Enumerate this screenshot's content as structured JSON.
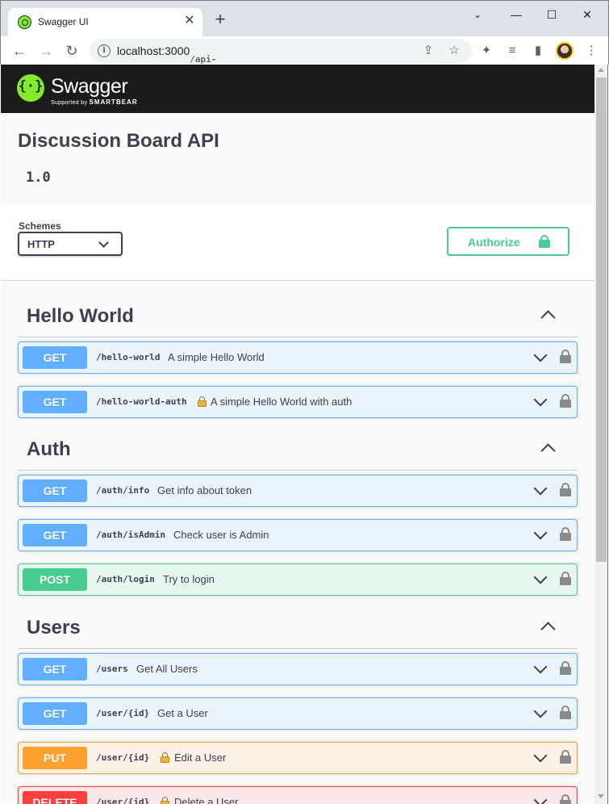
{
  "browser": {
    "tab_title": "Swagger UI",
    "tab_close": "✕",
    "new_tab": "+",
    "url_host": "localhost:3000",
    "url_path": "/api-docs/",
    "minimize": "—",
    "maximize": "☐",
    "close": "✕"
  },
  "swagger": {
    "logo_text": "Swagger",
    "logo_sub_prefix": "Supported by",
    "logo_sub_brand": "SMARTBEAR"
  },
  "info": {
    "title": "Discussion Board API",
    "version": "1.0"
  },
  "schemes": {
    "label": "Schemes",
    "selected": "HTTP"
  },
  "authorize": {
    "label": "Authorize"
  },
  "tags": [
    {
      "name": "Hello World",
      "operations": [
        {
          "method": "GET",
          "path": "/hello-world",
          "summary": "A simple Hello World",
          "locked": false
        },
        {
          "method": "GET",
          "path": "/hello-world-auth",
          "summary": "A simple Hello World with auth",
          "locked": true
        }
      ]
    },
    {
      "name": "Auth",
      "operations": [
        {
          "method": "GET",
          "path": "/auth/info",
          "summary": "Get info about token",
          "locked": false
        },
        {
          "method": "GET",
          "path": "/auth/isAdmin",
          "summary": "Check user is Admin",
          "locked": false
        },
        {
          "method": "POST",
          "path": "/auth/login",
          "summary": "Try to login",
          "locked": false
        }
      ]
    },
    {
      "name": "Users",
      "operations": [
        {
          "method": "GET",
          "path": "/users",
          "summary": "Get All Users",
          "locked": false
        },
        {
          "method": "GET",
          "path": "/user/{id}",
          "summary": "Get a User",
          "locked": false
        },
        {
          "method": "PUT",
          "path": "/user/{id}",
          "summary": "Edit a User",
          "locked": true
        },
        {
          "method": "DELETE",
          "path": "/user/{id}",
          "summary": "Delete a User",
          "locked": true
        }
      ]
    }
  ],
  "colors": {
    "get": "#61affe",
    "post": "#49cc90",
    "put": "#fca130",
    "delete": "#f93e3e",
    "topbar": "#1b1b1b",
    "logo": "#85ea2d"
  }
}
